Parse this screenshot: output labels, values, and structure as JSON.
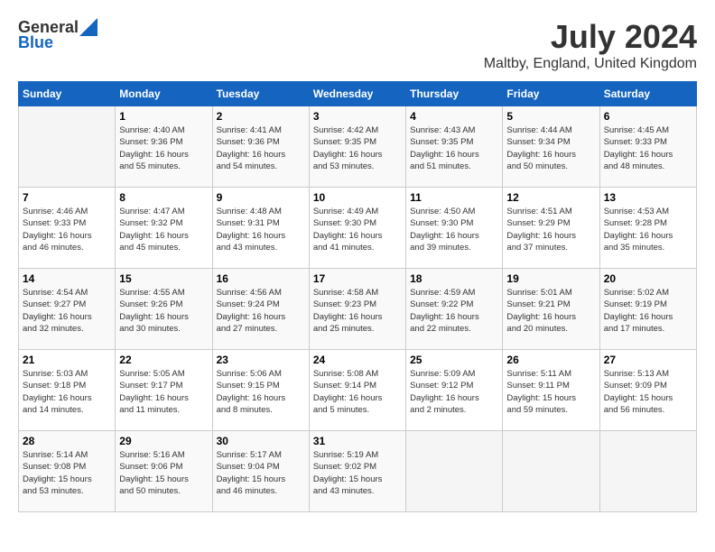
{
  "header": {
    "logo_general": "General",
    "logo_blue": "Blue",
    "month_title": "July 2024",
    "location": "Maltby, England, United Kingdom"
  },
  "days_of_week": [
    "Sunday",
    "Monday",
    "Tuesday",
    "Wednesday",
    "Thursday",
    "Friday",
    "Saturday"
  ],
  "weeks": [
    [
      {
        "num": "",
        "info": ""
      },
      {
        "num": "1",
        "info": "Sunrise: 4:40 AM\nSunset: 9:36 PM\nDaylight: 16 hours\nand 55 minutes."
      },
      {
        "num": "2",
        "info": "Sunrise: 4:41 AM\nSunset: 9:36 PM\nDaylight: 16 hours\nand 54 minutes."
      },
      {
        "num": "3",
        "info": "Sunrise: 4:42 AM\nSunset: 9:35 PM\nDaylight: 16 hours\nand 53 minutes."
      },
      {
        "num": "4",
        "info": "Sunrise: 4:43 AM\nSunset: 9:35 PM\nDaylight: 16 hours\nand 51 minutes."
      },
      {
        "num": "5",
        "info": "Sunrise: 4:44 AM\nSunset: 9:34 PM\nDaylight: 16 hours\nand 50 minutes."
      },
      {
        "num": "6",
        "info": "Sunrise: 4:45 AM\nSunset: 9:33 PM\nDaylight: 16 hours\nand 48 minutes."
      }
    ],
    [
      {
        "num": "7",
        "info": "Sunrise: 4:46 AM\nSunset: 9:33 PM\nDaylight: 16 hours\nand 46 minutes."
      },
      {
        "num": "8",
        "info": "Sunrise: 4:47 AM\nSunset: 9:32 PM\nDaylight: 16 hours\nand 45 minutes."
      },
      {
        "num": "9",
        "info": "Sunrise: 4:48 AM\nSunset: 9:31 PM\nDaylight: 16 hours\nand 43 minutes."
      },
      {
        "num": "10",
        "info": "Sunrise: 4:49 AM\nSunset: 9:30 PM\nDaylight: 16 hours\nand 41 minutes."
      },
      {
        "num": "11",
        "info": "Sunrise: 4:50 AM\nSunset: 9:30 PM\nDaylight: 16 hours\nand 39 minutes."
      },
      {
        "num": "12",
        "info": "Sunrise: 4:51 AM\nSunset: 9:29 PM\nDaylight: 16 hours\nand 37 minutes."
      },
      {
        "num": "13",
        "info": "Sunrise: 4:53 AM\nSunset: 9:28 PM\nDaylight: 16 hours\nand 35 minutes."
      }
    ],
    [
      {
        "num": "14",
        "info": "Sunrise: 4:54 AM\nSunset: 9:27 PM\nDaylight: 16 hours\nand 32 minutes."
      },
      {
        "num": "15",
        "info": "Sunrise: 4:55 AM\nSunset: 9:26 PM\nDaylight: 16 hours\nand 30 minutes."
      },
      {
        "num": "16",
        "info": "Sunrise: 4:56 AM\nSunset: 9:24 PM\nDaylight: 16 hours\nand 27 minutes."
      },
      {
        "num": "17",
        "info": "Sunrise: 4:58 AM\nSunset: 9:23 PM\nDaylight: 16 hours\nand 25 minutes."
      },
      {
        "num": "18",
        "info": "Sunrise: 4:59 AM\nSunset: 9:22 PM\nDaylight: 16 hours\nand 22 minutes."
      },
      {
        "num": "19",
        "info": "Sunrise: 5:01 AM\nSunset: 9:21 PM\nDaylight: 16 hours\nand 20 minutes."
      },
      {
        "num": "20",
        "info": "Sunrise: 5:02 AM\nSunset: 9:19 PM\nDaylight: 16 hours\nand 17 minutes."
      }
    ],
    [
      {
        "num": "21",
        "info": "Sunrise: 5:03 AM\nSunset: 9:18 PM\nDaylight: 16 hours\nand 14 minutes."
      },
      {
        "num": "22",
        "info": "Sunrise: 5:05 AM\nSunset: 9:17 PM\nDaylight: 16 hours\nand 11 minutes."
      },
      {
        "num": "23",
        "info": "Sunrise: 5:06 AM\nSunset: 9:15 PM\nDaylight: 16 hours\nand 8 minutes."
      },
      {
        "num": "24",
        "info": "Sunrise: 5:08 AM\nSunset: 9:14 PM\nDaylight: 16 hours\nand 5 minutes."
      },
      {
        "num": "25",
        "info": "Sunrise: 5:09 AM\nSunset: 9:12 PM\nDaylight: 16 hours\nand 2 minutes."
      },
      {
        "num": "26",
        "info": "Sunrise: 5:11 AM\nSunset: 9:11 PM\nDaylight: 15 hours\nand 59 minutes."
      },
      {
        "num": "27",
        "info": "Sunrise: 5:13 AM\nSunset: 9:09 PM\nDaylight: 15 hours\nand 56 minutes."
      }
    ],
    [
      {
        "num": "28",
        "info": "Sunrise: 5:14 AM\nSunset: 9:08 PM\nDaylight: 15 hours\nand 53 minutes."
      },
      {
        "num": "29",
        "info": "Sunrise: 5:16 AM\nSunset: 9:06 PM\nDaylight: 15 hours\nand 50 minutes."
      },
      {
        "num": "30",
        "info": "Sunrise: 5:17 AM\nSunset: 9:04 PM\nDaylight: 15 hours\nand 46 minutes."
      },
      {
        "num": "31",
        "info": "Sunrise: 5:19 AM\nSunset: 9:02 PM\nDaylight: 15 hours\nand 43 minutes."
      },
      {
        "num": "",
        "info": ""
      },
      {
        "num": "",
        "info": ""
      },
      {
        "num": "",
        "info": ""
      }
    ]
  ]
}
